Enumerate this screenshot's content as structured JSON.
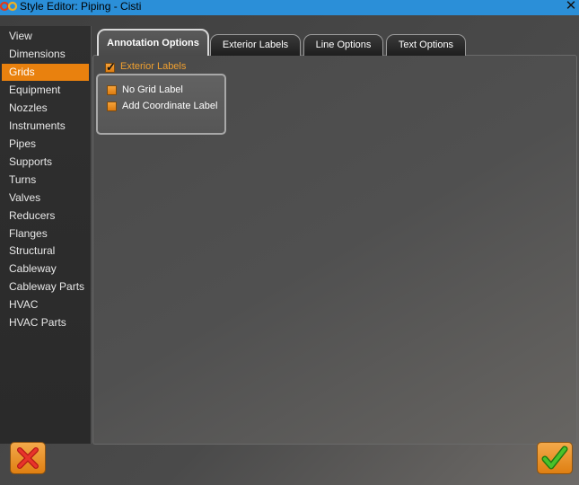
{
  "window": {
    "title": "Style Editor: Piping - Cisti"
  },
  "sidebar": {
    "items": [
      {
        "label": "View"
      },
      {
        "label": "Dimensions"
      },
      {
        "label": "Grids",
        "active": true
      },
      {
        "label": "Equipment"
      },
      {
        "label": "Nozzles"
      },
      {
        "label": "Instruments"
      },
      {
        "label": "Pipes"
      },
      {
        "label": "Supports"
      },
      {
        "label": "Turns"
      },
      {
        "label": "Valves"
      },
      {
        "label": "Reducers"
      },
      {
        "label": "Flanges"
      },
      {
        "label": "Structural"
      },
      {
        "label": "Cableway"
      },
      {
        "label": "Cableway Parts"
      },
      {
        "label": "HVAC"
      },
      {
        "label": "HVAC Parts"
      }
    ]
  },
  "tabs": [
    {
      "label": "Annotation Options",
      "active": true
    },
    {
      "label": "Exterior Labels"
    },
    {
      "label": "Line Options"
    },
    {
      "label": "Text Options"
    }
  ],
  "annotation": {
    "group_label": "Exterior Labels",
    "group_checked": true,
    "options": [
      {
        "label": "No Grid Label",
        "checked": false
      },
      {
        "label": "Add Coordinate Label",
        "checked": false
      }
    ]
  },
  "colors": {
    "accent": "#e9810e",
    "titlebar": "#2b8fd8",
    "group_label": "#f0a030"
  }
}
